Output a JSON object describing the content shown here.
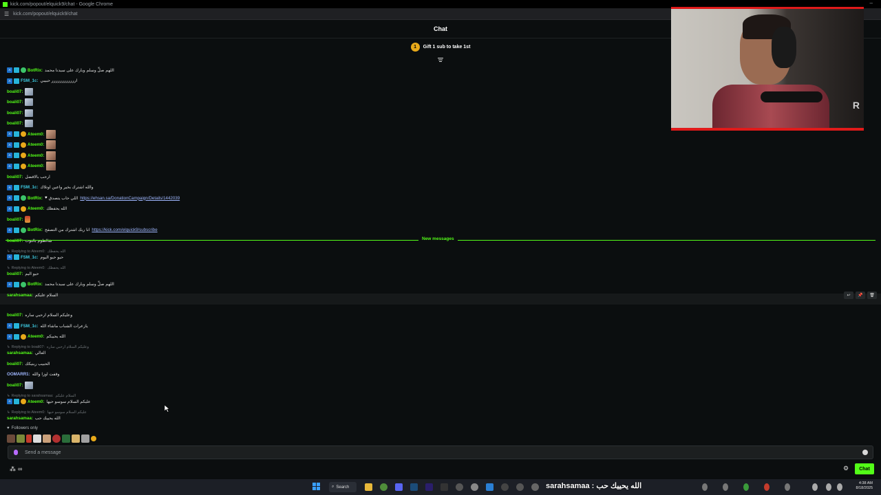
{
  "browser": {
    "title": "kick.com/popout/elquick9/chat - Google Chrome",
    "url": "kick.com/popout/elquick9/chat"
  },
  "chat": {
    "header": "Chat",
    "gift_badge": "1",
    "gift_prompt": "Gift 1 sub to take 1st",
    "new_messages_label": "New messages"
  },
  "messages": [
    {
      "user": "BotRix:",
      "color": "#53fc18",
      "badges": [
        "mod",
        "sub",
        "bot"
      ],
      "text": "اللهم صلِّ وسلم وبارك على سيدنا محمد"
    },
    {
      "user": "FSM_1c:",
      "color": "#3fd0e8",
      "badges": [
        "mod",
        "sub"
      ],
      "text": "ارررررررررررر حبيبي"
    },
    {
      "user": "boali07:",
      "color": "#53fc18",
      "badges": [],
      "emote": "pic"
    },
    {
      "user": "boali07:",
      "color": "#53fc18",
      "badges": [],
      "emote": "pic"
    },
    {
      "user": "boali07:",
      "color": "#53fc18",
      "badges": [],
      "emote": "pic"
    },
    {
      "user": "boali07:",
      "color": "#53fc18",
      "badges": [],
      "emote": "pic"
    },
    {
      "user": "Ateem0:",
      "color": "#53fc18",
      "badges": [
        "mod",
        "sub",
        "gift"
      ],
      "emote": "face"
    },
    {
      "user": "Ateem0:",
      "color": "#53fc18",
      "badges": [
        "mod",
        "sub",
        "gift"
      ],
      "emote": "face"
    },
    {
      "user": "Ateem0:",
      "color": "#53fc18",
      "badges": [
        "mod",
        "sub",
        "gift"
      ],
      "emote": "face"
    },
    {
      "user": "Ateem0:",
      "color": "#53fc18",
      "badges": [
        "mod",
        "sub",
        "gift"
      ],
      "emote": "face"
    },
    {
      "user": "boali07:",
      "color": "#53fc18",
      "badges": [],
      "text": "ارحب بالافضل"
    },
    {
      "user": "FSM_1c:",
      "color": "#3fd0e8",
      "badges": [
        "mod",
        "sub"
      ],
      "text": "والله اشترك بخير واعين اوتلاك"
    },
    {
      "user": "BotRix:",
      "color": "#53fc18",
      "badges": [
        "mod",
        "sub",
        "bot"
      ],
      "heart": "♥",
      "text": "اللي حاب يتصدق",
      "link": "https://ehsan.sa/DonationCampaign/Details/1442039"
    },
    {
      "user": "Ateem0:",
      "color": "#53fc18",
      "badges": [
        "mod",
        "sub",
        "gift"
      ],
      "text": "الله يحفظك"
    },
    {
      "user": "boali07:",
      "color": "#53fc18",
      "badges": [],
      "emote": "drink"
    },
    {
      "user": "BotRix:",
      "color": "#53fc18",
      "badges": [
        "mod",
        "sub",
        "bot"
      ],
      "text": "انا ربك اشترك من التصفح",
      "link": "https://kick.com/elquick9/subscribe"
    },
    {
      "user": "boali07:",
      "color": "#53fc18",
      "badges": [],
      "text": "شالطوم بالتوت"
    },
    {
      "reply": "Replying to Ateem0:",
      "reply_text": "الله يحفظك"
    },
    {
      "user": "FSM_1c:",
      "color": "#3fd0e8",
      "badges": [
        "mod",
        "sub"
      ],
      "text": "حيو حيو اليوم"
    },
    {
      "reply": "Replying to Ateem0:",
      "reply_text": "الله يحفظك"
    },
    {
      "user": "boali07:",
      "color": "#53fc18",
      "badges": [],
      "text": "حيو اليم"
    },
    {
      "user": "BotRix:",
      "color": "#53fc18",
      "badges": [
        "mod",
        "sub",
        "bot"
      ],
      "text": "اللهم صلِّ وسلم وبارك على سيدنا محمد"
    },
    {
      "user": "sarahsamaa:",
      "color": "#53fc18",
      "badges": [],
      "text": "السلام عليكم"
    },
    {
      "user": "boali07:",
      "color": "#53fc18",
      "badges": [],
      "text": "وعليكم السلام ارحبي ساره"
    },
    {
      "user": "FSM_1c:",
      "color": "#3fd0e8",
      "badges": [
        "mod",
        "sub"
      ],
      "text": "يازعرات الشباب ماشاء الله"
    },
    {
      "user": "Ateem0:",
      "color": "#53fc18",
      "badges": [
        "mod",
        "sub",
        "gift"
      ],
      "text": "الله يحييكم"
    },
    {
      "reply": "Replying to boali07:",
      "reply_text": "وعليكم السلام ارحبي ساره"
    },
    {
      "user": "sarahsamaa:",
      "color": "#53fc18",
      "badges": [],
      "text": "الغالي"
    },
    {
      "user": "boali07:",
      "color": "#53fc18",
      "badges": [],
      "text": "الحبيب ربنيكك"
    },
    {
      "user": "OOMARR1:",
      "color": "#9fb7ff",
      "badges": [],
      "text": "وقفت اوزا والله"
    },
    {
      "user": "boali07:",
      "color": "#53fc18",
      "badges": [],
      "emote": "pic"
    },
    {
      "reply": "Replying to sarahsamaa:",
      "reply_text": "السلام عليكم"
    },
    {
      "user": "Ateem0:",
      "color": "#53fc18",
      "badges": [
        "mod",
        "sub",
        "gift"
      ],
      "text": "عليكم السلام سوسو حيها"
    },
    {
      "reply": "Replying to Ateem0:",
      "reply_text": "عليكم السلام سوسو حيها"
    },
    {
      "user": "sarahsamaa:",
      "color": "#53fc18",
      "badges": [],
      "text": "الله يحييك حب"
    }
  ],
  "followers_label": "Followers only",
  "composer": {
    "placeholder": "Send a message",
    "chat_button": "Chat"
  },
  "taskbar": {
    "search_label": "Search",
    "overlay_text": "sarahsamaa : الله يحييك حب",
    "time": "4:38 AM",
    "date": "8/18/2025"
  },
  "colors": {
    "accent": "#53fc18",
    "background": "#0b0e0f",
    "webcam_frame": "#e01a1a"
  }
}
